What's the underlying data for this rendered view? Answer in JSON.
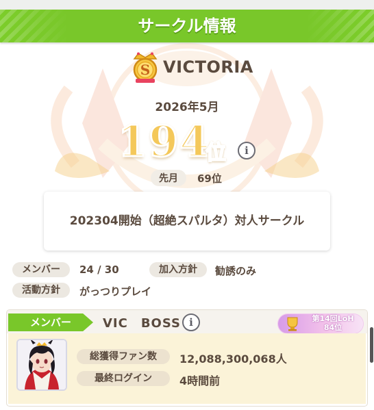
{
  "header": {
    "title": "サークル情報"
  },
  "circle": {
    "name": "VICTORIA",
    "rank_badge_letter": "S",
    "month_label": "2026年5月",
    "rank_number": "194",
    "rank_unit": "位",
    "last_month_label": "先月",
    "last_month_value": "69位",
    "description": "202304開始（超絶スパルタ）対人サークル"
  },
  "properties": {
    "members_label": "メンバー",
    "members_value": "24 / 30",
    "join_policy_label": "加入方針",
    "join_policy_value": "勧誘のみ",
    "activity_label": "活動方針",
    "activity_value": "がっつりプレイ"
  },
  "member": {
    "tab_label": "メンバー",
    "name": "VIC　BOSS",
    "loh_line1": "第14回LoH",
    "loh_line2": "84位",
    "fans_label": "総獲得ファン数",
    "fans_value": "12,088,300,068人",
    "login_label": "最終ログイン",
    "login_value": "4時間前"
  },
  "icons": {
    "info": "i",
    "info_icon_name": "info-icon",
    "badge_icon_name": "rank-s-badge-icon"
  },
  "colors": {
    "accent_green": "#79c72a",
    "text_brown": "#5a4a3e",
    "rank_gold": "#f4c85a",
    "loh_purple": "#d79be8"
  }
}
